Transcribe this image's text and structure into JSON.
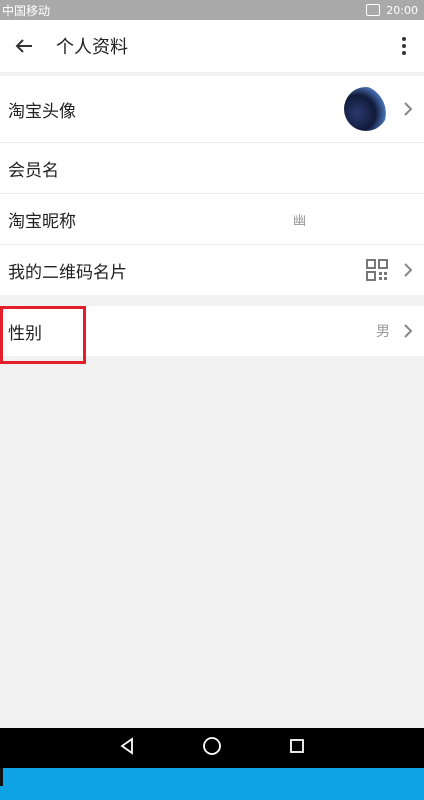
{
  "statusbar": {
    "carrier": "中国移动",
    "time": "20:00"
  },
  "header": {
    "title": "个人资料"
  },
  "profile_rows": [
    {
      "label": "淘宝头像"
    },
    {
      "label": "会员名",
      "value": ""
    },
    {
      "label": "淘宝昵称",
      "value": "幽"
    },
    {
      "label": "我的二维码名片"
    }
  ],
  "gender_row": {
    "label": "性别",
    "value": "男"
  },
  "colors": {
    "highlight": "#e21f2a",
    "accent_bottom": "#0ea3e4"
  },
  "icons": [
    "back-arrow-icon",
    "more-vertical-icon",
    "chevron-right-icon",
    "qr-code-icon",
    "nav-back-icon",
    "nav-home-icon",
    "nav-recents-icon"
  ]
}
